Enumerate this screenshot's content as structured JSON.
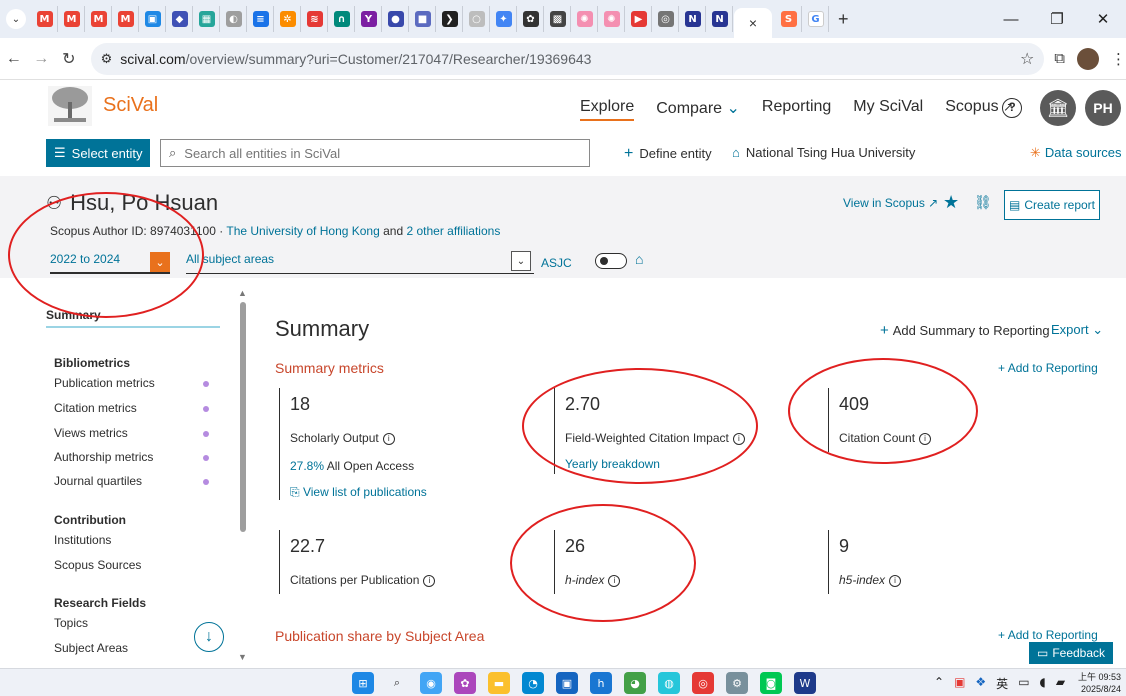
{
  "browser": {
    "address_host": "scival.com",
    "address_path": "/overview/summary?uri=Customer/217047/Researcher/19369643",
    "active_tab_close": "×",
    "new_tab": "+"
  },
  "app": {
    "brand": "SciVal",
    "nav": [
      "Explore",
      "Compare",
      "Reporting",
      "My SciVal",
      "Scopus"
    ],
    "user_initials": "PH",
    "select_entity": "Select entity",
    "search_placeholder": "Search all entities in SciVal",
    "define_entity": "Define entity",
    "institution": "National Tsing Hua University",
    "data_sources": "Data sources"
  },
  "entity": {
    "name": "Hsu, Po Hsuan",
    "author_id_text": "Scopus Author ID: 8974031100  ·  ",
    "affiliation": "The University of Hong Kong",
    "and_text": " and ",
    "other_affiliations": "2 other affiliations",
    "year_range": "2022 to 2024",
    "subject_areas": "All subject areas",
    "asjc": "ASJC",
    "view_in_scopus": "View in Scopus",
    "create_report": "Create report"
  },
  "sidebar": {
    "summary": "Summary",
    "bibliometrics": "Bibliometrics",
    "bib_items": [
      "Publication metrics",
      "Citation metrics",
      "Views metrics",
      "Authorship metrics",
      "Journal quartiles"
    ],
    "contribution": "Contribution",
    "contrib_items": [
      "Institutions",
      "Scopus Sources"
    ],
    "research_fields": "Research Fields",
    "rf_items": [
      "Topics",
      "Subject Areas"
    ]
  },
  "main": {
    "title": "Summary",
    "add_summary": "Add Summary to Reporting",
    "export": "Export",
    "metrics_title": "Summary metrics",
    "add_to_reporting": "Add to Reporting",
    "scholarly_output": {
      "value": "18",
      "label": "Scholarly Output",
      "oa_pct": "27.8%",
      "oa_text": " All Open Access",
      "link": "View list of publications"
    },
    "fwci": {
      "value": "2.70",
      "label": "Field-Weighted Citation Impact",
      "link": "Yearly breakdown"
    },
    "citation_count": {
      "value": "409",
      "label": "Citation Count"
    },
    "cpp": {
      "value": "22.7",
      "label": "Citations per Publication"
    },
    "h_index": {
      "value": "26",
      "label": "h-index"
    },
    "h5_index": {
      "value": "9",
      "label": "h5-index"
    },
    "pub_share": "Publication share by Subject Area",
    "add_to_reporting_2": "Add to Reporting",
    "feedback": "Feedback"
  },
  "taskbar": {
    "lang": "英",
    "time": "上午 09:53",
    "date": "2025/8/24"
  },
  "colors": {
    "accent": "#007398",
    "brand": "#e9711c",
    "section_heading": "#c8462b",
    "annotation": "#e02020"
  }
}
